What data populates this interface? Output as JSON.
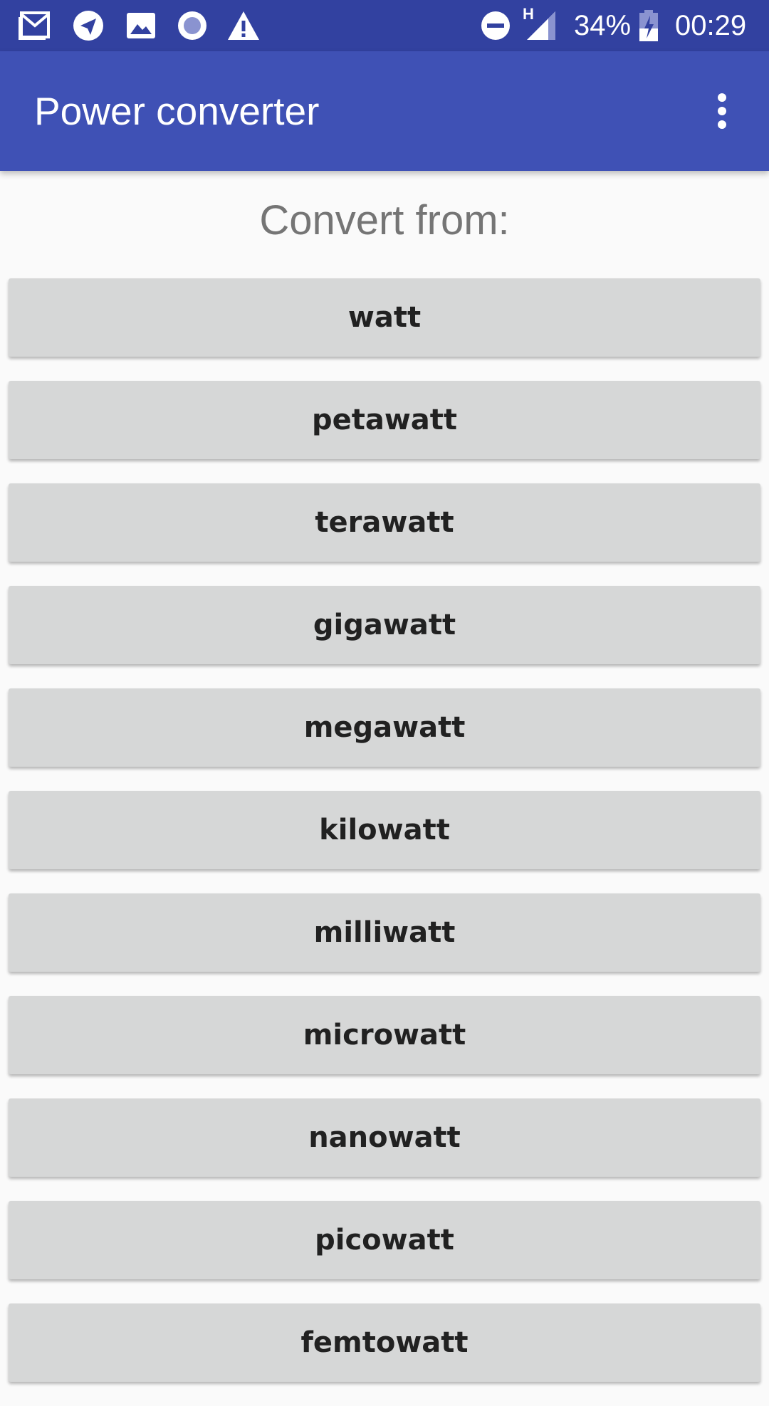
{
  "status_bar": {
    "icons_left": [
      "gmail-icon",
      "telegram-icon",
      "gallery-icon",
      "record-icon",
      "warning-icon"
    ],
    "icons_right": [
      "do-not-disturb-icon",
      "signal-icon",
      "battery-icon"
    ],
    "network_label": "H",
    "battery": "34%",
    "time": "00:29"
  },
  "app_bar": {
    "title": "Power converter",
    "menu_icon": "more-vert-icon"
  },
  "heading": "Convert from:",
  "units": [
    "watt",
    "petawatt",
    "terawatt",
    "gigawatt",
    "megawatt",
    "kilowatt",
    "milliwatt",
    "microwatt",
    "nanowatt",
    "picowatt",
    "femtowatt"
  ],
  "colors": {
    "status_bar": "#3241a0",
    "app_bar": "#3f51b5",
    "button": "#d6d7d7",
    "heading_text": "#757575",
    "button_text": "#212121"
  }
}
